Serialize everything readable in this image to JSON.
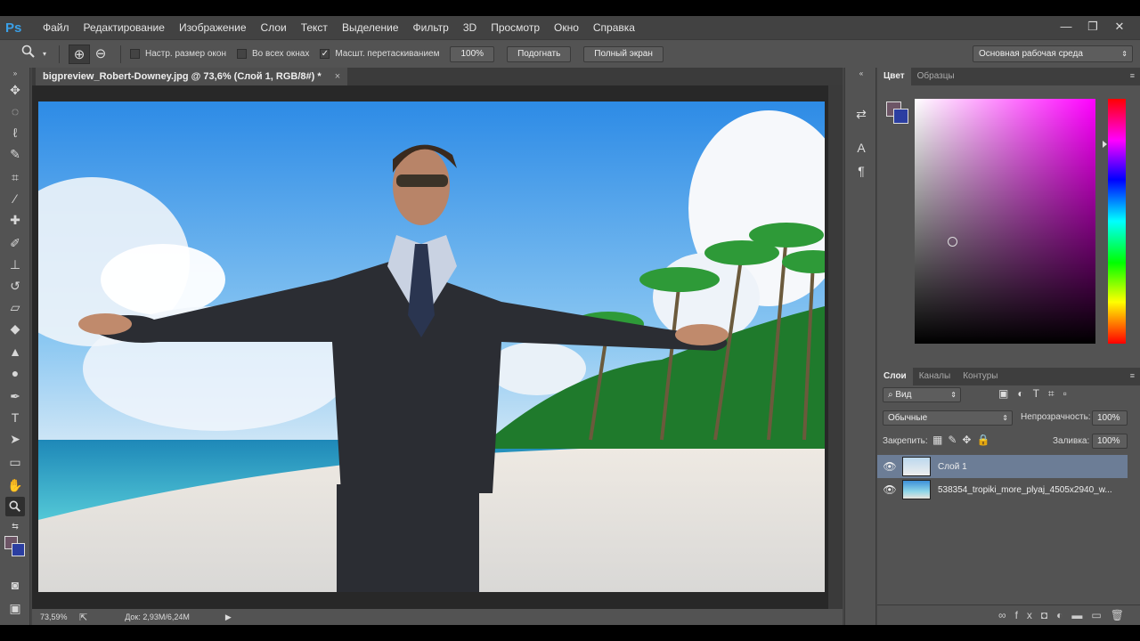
{
  "app": {
    "logo": "Ps",
    "menu": [
      "Файл",
      "Редактирование",
      "Изображение",
      "Слои",
      "Текст",
      "Выделение",
      "Фильтр",
      "3D",
      "Просмотр",
      "Окно",
      "Справка"
    ],
    "window_controls": {
      "minimize": "—",
      "restore": "❐",
      "close": "✕"
    }
  },
  "options": {
    "zoom_in_icon": "⊕",
    "zoom_out_icon": "⊖",
    "resize_windows": {
      "label": "Настр. размер окон",
      "checked": false
    },
    "all_windows": {
      "label": "Во всех окнах",
      "checked": false
    },
    "scrubby_zoom": {
      "label": "Масшт. перетаскиванием",
      "checked": true
    },
    "btn_100": "100%",
    "btn_fit": "Подогнать",
    "btn_fullscreen": "Полный экран",
    "workspace": "Основная рабочая среда"
  },
  "document": {
    "tab_title": "bigpreview_Robert-Downey.jpg @ 73,6% (Слой 1, RGB/8#) *",
    "close_label": "×"
  },
  "status": {
    "zoom": "73,59%",
    "doc_info": "Док: 2,93M/6,24M"
  },
  "color_panel": {
    "tabs": [
      "Цвет",
      "Образцы"
    ],
    "foreground": "#6d5566",
    "background": "#2b3ea1"
  },
  "layers_panel": {
    "tabs": [
      "Слои",
      "Каналы",
      "Контуры"
    ],
    "filter_kind": "Вид",
    "blend_mode": "Обычные",
    "opacity_label": "Непрозрачность:",
    "opacity_value": "100%",
    "lock_label": "Закрепить:",
    "fill_label": "Заливка:",
    "fill_value": "100%",
    "layers": [
      {
        "name": "Слой 1",
        "selected": true
      },
      {
        "name": "538354_tropiki_more_plyaj_4505x2940_w...",
        "selected": false
      }
    ]
  },
  "icons": {
    "tools": [
      "move-icon",
      "marquee-icon",
      "lasso-icon",
      "quick-select-icon",
      "crop-icon",
      "eyedropper-icon",
      "healing-icon",
      "brush-icon",
      "stamp-icon",
      "history-brush-icon",
      "eraser-icon",
      "bucket-icon",
      "blur-icon",
      "dodge-icon",
      "pen-icon",
      "type-icon",
      "path-select-icon",
      "rectangle-icon",
      "hand-icon",
      "zoom-icon"
    ]
  }
}
